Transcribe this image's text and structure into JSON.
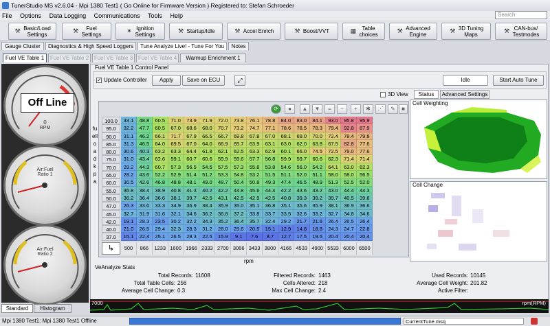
{
  "window": {
    "title": "TunerStudio MS v2.6.04 - Mpi 1380 Test1 ( Go Online for Firmware Version ) Registered to: Stefan Schroeder"
  },
  "menu": [
    "File",
    "Options",
    "Data Logging",
    "Communications",
    "Tools",
    "Help"
  ],
  "search": {
    "placeholder": "Search"
  },
  "toolbar": [
    {
      "label": "Basic/Load\nSettings",
      "icon": "wrench-icon",
      "glyph": "⚒"
    },
    {
      "label": "Fuel\nSettings",
      "icon": "wrench-icon",
      "glyph": "⚒"
    },
    {
      "label": "Ignition\nSettings",
      "icon": "spark-icon",
      "glyph": "✶"
    },
    {
      "label": "Startup/Idle",
      "icon": "wrench-icon",
      "glyph": "⚒"
    },
    {
      "label": "Accel Enrich",
      "icon": "wrench-icon",
      "glyph": "⚒"
    },
    {
      "label": "Boost/VVT",
      "icon": "wrench-icon",
      "glyph": "⚒"
    },
    {
      "label": "Table\nchoices",
      "icon": "table-icon",
      "glyph": "▦"
    },
    {
      "label": "Advanced\nEngine",
      "icon": "wrench-icon",
      "glyph": "⚒"
    },
    {
      "label": "3D Tuning\nMaps",
      "icon": "wrench-icon",
      "glyph": "⚒"
    },
    {
      "label": "CAN-bus/\nTestmodes",
      "icon": "wrench-icon",
      "glyph": "⚒"
    }
  ],
  "main_tabs": [
    "Gauge Cluster",
    "Diagnostics & High Speed Loggers",
    "Tune Analyze Live! - Tune For You",
    "Notes"
  ],
  "sub_tabs": [
    "Fuel VE Table 1",
    "Fuel VE Table 2",
    "Fuel VE Table 3",
    "Fuel VE Table 4",
    "Warmup Enrichment 1"
  ],
  "gauges": {
    "offline": "Off Line",
    "g1_label": "RPM",
    "g1_value": "0",
    "g2_label": "Air:Fuel\nRatio 1",
    "g3_label": "Air:Fuel\nRatio 2"
  },
  "left_tabs": [
    "Standard",
    "Histogram"
  ],
  "control_panel": {
    "title": "Fuel VE Table 1 Control Panel",
    "update_controller": "Update Controller",
    "apply": "Apply",
    "save_ecu": "Save on ECU",
    "idle": "Idle",
    "start_auto_tune": "Start Auto Tune",
    "view_3d": "3D View"
  },
  "y_axis_title": "fuelload\nkpa",
  "x_axis_title": "rpm",
  "table": {
    "y": [
      "100.0",
      "95.0",
      "90.0",
      "85.0",
      "80.0",
      "75.0",
      "70.0",
      "65.0",
      "60.0",
      "55.0",
      "50.0",
      "47.0",
      "45.0",
      "42.0",
      "40.0",
      "37.0"
    ],
    "x": [
      "500",
      "866",
      "1233",
      "1600",
      "1966",
      "2333",
      "2700",
      "3066",
      "3433",
      "3800",
      "4166",
      "4533",
      "4900",
      "5533",
      "6000",
      "6500"
    ],
    "values": [
      [
        "33.1",
        "48.8",
        "60.5",
        "71.0",
        "73.9",
        "71.9",
        "72.0",
        "73.8",
        "76.1",
        "78.8",
        "84.0",
        "83.0",
        "84.1",
        "93.0",
        "95.8",
        "95.9"
      ],
      [
        "32.2",
        "47.7",
        "60.5",
        "67.0",
        "68.6",
        "68.0",
        "70.7",
        "73.2",
        "74.7",
        "77.1",
        "78.6",
        "78.5",
        "78.3",
        "79.4",
        "92.8",
        "87.9"
      ],
      [
        "31.1",
        "46.2",
        "66.1",
        "71.7",
        "67.9",
        "66.5",
        "66.7",
        "69.8",
        "67.8",
        "67.0",
        "68.1",
        "69.0",
        "70.0",
        "72.4",
        "78.4",
        "79.8"
      ],
      [
        "31.3",
        "46.5",
        "64.0",
        "69.5",
        "67.0",
        "64.0",
        "66.9",
        "65.7",
        "63.9",
        "63.1",
        "63.0",
        "62.0",
        "63.8",
        "67.5",
        "82.8",
        "77.6"
      ],
      [
        "30.6",
        "40.3",
        "63.2",
        "63.3",
        "64.4",
        "61.8",
        "62.1",
        "62.5",
        "63.3",
        "62.9",
        "60.1",
        "66.0",
        "74.5",
        "72.5",
        "79.0",
        "77.6"
      ],
      [
        "31.0",
        "43.4",
        "62.6",
        "59.1",
        "60.7",
        "60.6",
        "59.9",
        "59.6",
        "57.7",
        "56.8",
        "59.9",
        "59.7",
        "60.6",
        "62.3",
        "71.4",
        "71.4"
      ],
      [
        "29.2",
        "44.3",
        "60.7",
        "57.3",
        "56.5",
        "54.5",
        "57.5",
        "57.3",
        "55.8",
        "53.8",
        "54.6",
        "56.0",
        "54.2",
        "64.1",
        "63.0",
        "62.3"
      ],
      [
        "28.2",
        "43.6",
        "52.2",
        "52.9",
        "51.4",
        "51.2",
        "53.3",
        "54.8",
        "53.2",
        "51.5",
        "51.1",
        "52.0",
        "51.1",
        "58.0",
        "58.0",
        "56.5"
      ],
      [
        "30.5",
        "42.6",
        "46.8",
        "48.8",
        "48.1",
        "49.0",
        "48.7",
        "50.4",
        "50.8",
        "49.3",
        "47.4",
        "46.5",
        "48.9",
        "51.3",
        "52.5",
        "52.0"
      ],
      [
        "36.8",
        "38.4",
        "38.9",
        "40.8",
        "41.3",
        "40.2",
        "42.2",
        "44.8",
        "45.6",
        "44.4",
        "42.2",
        "43.6",
        "43.2",
        "43.0",
        "44.4",
        "44.3"
      ],
      [
        "36.2",
        "36.4",
        "36.6",
        "38.1",
        "39.7",
        "42.5",
        "43.1",
        "42.5",
        "42.9",
        "42.5",
        "40.8",
        "39.3",
        "39.2",
        "39.7",
        "40.5",
        "39.8"
      ],
      [
        "26.3",
        "33.6",
        "33.3",
        "34.9",
        "36.9",
        "38.4",
        "35.9",
        "35.0",
        "35.1",
        "36.8",
        "35.1",
        "35.6",
        "35.9",
        "38.1",
        "36.9",
        "36.6"
      ],
      [
        "32.7",
        "31.9",
        "31.6",
        "32.1",
        "34.6",
        "36.2",
        "36.8",
        "37.2",
        "33.8",
        "33.7",
        "33.5",
        "32.6",
        "33.2",
        "32.7",
        "34.8",
        "34.6"
      ],
      [
        "19.1",
        "28.3",
        "23.5",
        "30.2",
        "32.2",
        "34.3",
        "35.2",
        "36.4",
        "35.7",
        "32.4",
        "29.2",
        "21.7",
        "21.6",
        "26.4",
        "26.5",
        "26.4"
      ],
      [
        "21.0",
        "26.5",
        "29.4",
        "32.3",
        "28.3",
        "31.2",
        "28.0",
        "25.6",
        "20.5",
        "15.1",
        "12.9",
        "14.8",
        "18.8",
        "24.3",
        "24.7",
        "22.8"
      ],
      [
        "15.1",
        "22.4",
        "25.1",
        "26.5",
        "28.3",
        "22.5",
        "15.9",
        "9.1",
        "7.6",
        "8.7",
        "12.7",
        "17.5",
        "19.5",
        "20.4",
        "20.4",
        "20.4"
      ]
    ]
  },
  "right_panel": {
    "tabs": [
      "Status",
      "Advanced Settings"
    ],
    "cell_weighting": "Cell Weighting",
    "cell_change": "Cell Change"
  },
  "stats": {
    "title": "VeAnalyze Stats",
    "total_records_label": "Total Records:",
    "total_records": "11608",
    "filtered_records_label": "Filtered Records:",
    "filtered_records": "1463",
    "used_records_label": "Used Records:",
    "used_records": "10145",
    "total_cells_label": "Total Table Cells:",
    "total_cells": "256",
    "cells_altered_label": "Cells Altered:",
    "cells_altered": "218",
    "avg_weight_label": "Average Cell Weight:",
    "avg_weight": "201.82",
    "avg_change_label": "Average Cell Change:",
    "avg_change": "0.3",
    "max_change_label": "Max Cell Change:",
    "max_change": "2.4",
    "active_filter_label": "Active Filter:",
    "active_filter": ""
  },
  "graph": {
    "left_label": "7000",
    "right_label": "rpm(RPM)"
  },
  "statusbar": {
    "left": "Mpi 1380 Test1: Mpi 1380 Test1 Offline",
    "file": "CurrentTune.msq"
  }
}
